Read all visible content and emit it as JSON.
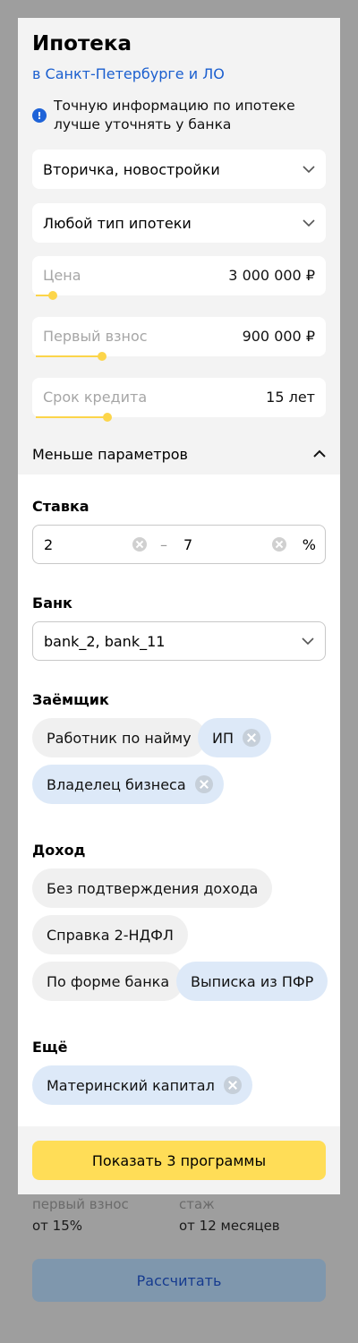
{
  "background": {
    "col1": {
      "label": "первый взнос",
      "value": "от 15%"
    },
    "col2": {
      "label": "стаж",
      "value": "от 12 месяцев"
    },
    "calc_button": "Рассчитать"
  },
  "header": {
    "title": "Ипотека",
    "region": "в Санкт-Петербурге и ЛО",
    "info_text": "Точную информацию по ипотеке лучше уточнять у банка"
  },
  "filters": {
    "market": "Вторичка, новостройки",
    "mortgage_type": "Любой тип ипотеки",
    "price": {
      "placeholder": "Цена",
      "value": "3 000 000 ₽",
      "fill": 0.06
    },
    "down_payment": {
      "placeholder": "Первый взнос",
      "value": "900 000 ₽",
      "fill": 0.23
    },
    "term": {
      "placeholder": "Срок кредита",
      "value": "15 лет",
      "fill": 0.25
    },
    "toggle_label": "Меньше параметров"
  },
  "rate": {
    "title": "Ставка",
    "from": "2",
    "dash": "–",
    "to": "7",
    "unit": "%"
  },
  "bank": {
    "title": "Банк",
    "value": "bank_2, bank_11"
  },
  "borrower": {
    "title": "Заёмщик",
    "chips": [
      {
        "label": "Работник по найму",
        "selected": false
      },
      {
        "label": "ИП",
        "selected": true
      },
      {
        "label": "Владелец бизнеса",
        "selected": true
      }
    ]
  },
  "income": {
    "title": "Доход",
    "chips": [
      {
        "label": "Без подтверждения дохода",
        "selected": false
      },
      {
        "label": "Справка 2-НДФЛ",
        "selected": false
      },
      {
        "label": "По форме банка",
        "selected": false
      },
      {
        "label": "Выписка из ПФР",
        "selected": true
      }
    ]
  },
  "more": {
    "title": "Ещё",
    "chips": [
      {
        "label": "Материнский капитал",
        "selected": true
      }
    ]
  },
  "submit": {
    "label": "Показать 3 программы"
  },
  "colors": {
    "accent": "#ffdd57",
    "slider": "#fcd54a",
    "link": "#1b5fcf",
    "chip_selected": "#dde9f8"
  }
}
